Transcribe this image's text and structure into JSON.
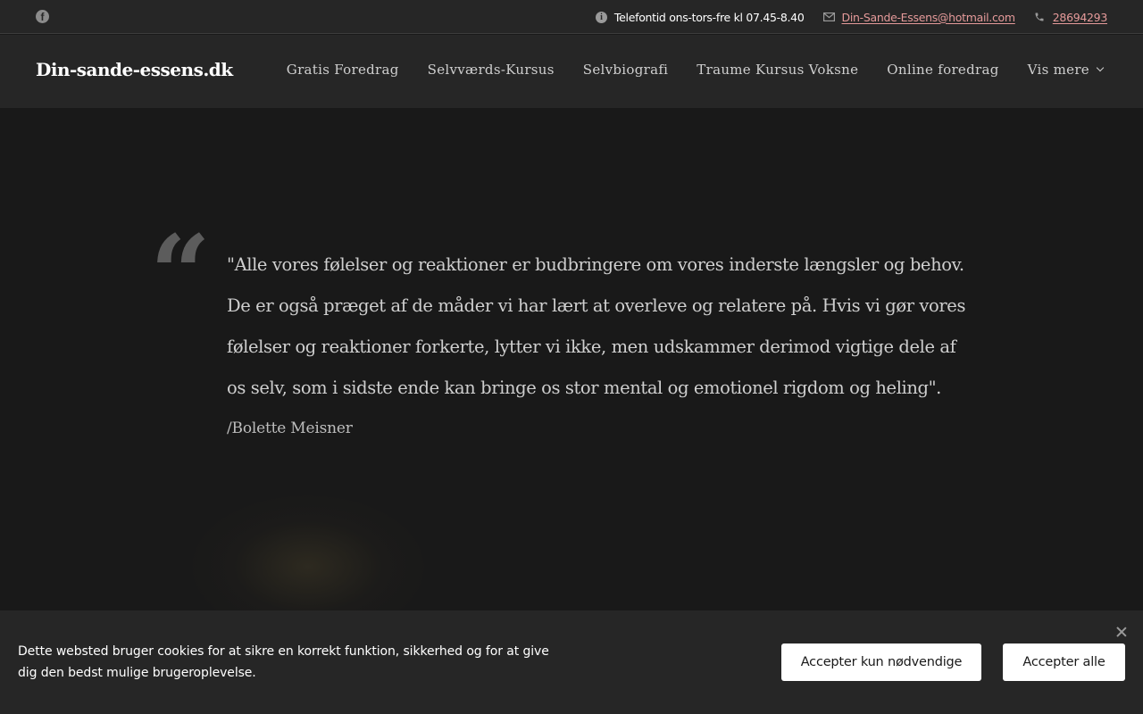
{
  "topbar": {
    "facebook_icon": "facebook-icon",
    "info_icon": "info-icon",
    "phone_hours": "Telefontid ons-tors-fre kl 07.45-8.40",
    "mail_icon": "mail-icon",
    "email": "Din-Sande-Essens@hotmail.com",
    "phone_icon": "phone-icon",
    "phone": "28694293"
  },
  "header": {
    "logo": "Din-sande-essens.dk",
    "nav": [
      {
        "label": "Gratis Foredrag"
      },
      {
        "label": "Selvværds-Kursus"
      },
      {
        "label": "Selvbiografi"
      },
      {
        "label": "Traume Kursus Voksne"
      },
      {
        "label": "Online foredrag"
      },
      {
        "label": "Vis mere"
      }
    ]
  },
  "quote": {
    "mark": "“",
    "text": "\"Alle vores følelser og reaktioner er budbringere om vores inderste længsler og behov. De er også præget af de måder vi har lært at overleve og relatere på. Hvis vi gør vores følelser og reaktioner forkerte, lytter vi ikke, men udskammer derimod vigtige dele af os selv, som i sidste ende kan bringe os stor mental og emotionel rigdom og heling\".",
    "author": "/Bolette Meisner"
  },
  "cookie_banner": {
    "text": "Dette websted bruger cookies for at sikre en korrekt funktion, sikkerhed og for at give dig den bedst mulige brugeroplevelse.",
    "btn_necessary": "Accepter kun nødvendige",
    "btn_all": "Accepter alle",
    "close_icon": "close-icon"
  },
  "colors": {
    "background": "#191919",
    "bar": "#262626",
    "link": "#e59a9a"
  }
}
